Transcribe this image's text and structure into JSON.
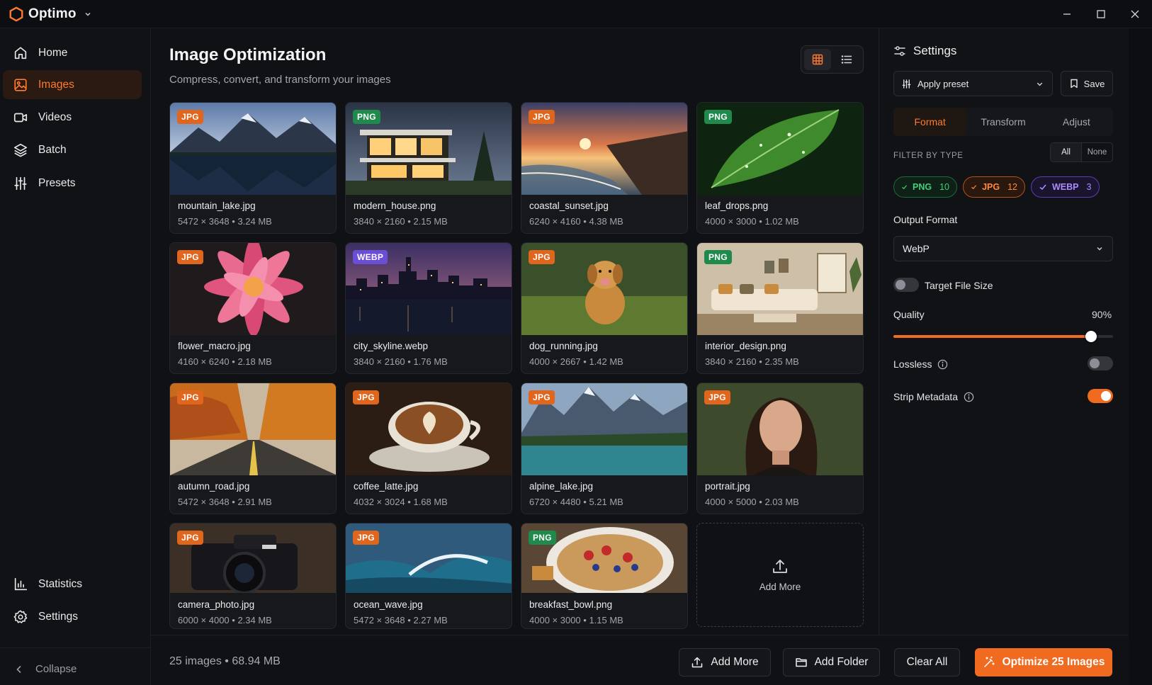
{
  "app": {
    "name": "Optimo"
  },
  "sidebar": {
    "items": [
      {
        "label": "Home",
        "icon": "home-icon"
      },
      {
        "label": "Images",
        "icon": "image-icon",
        "active": true
      },
      {
        "label": "Videos",
        "icon": "video-icon"
      },
      {
        "label": "Batch",
        "icon": "layers-icon"
      },
      {
        "label": "Presets",
        "icon": "sliders-icon"
      }
    ],
    "bottom_items": [
      {
        "label": "Statistics",
        "icon": "bar-chart-icon"
      },
      {
        "label": "Settings",
        "icon": "gear-icon"
      }
    ],
    "collapse_label": "Collapse"
  },
  "main": {
    "title": "Image Optimization",
    "subtitle": "Compress, convert, and transform your images",
    "view_mode": "grid"
  },
  "images": [
    {
      "name": "mountain_lake.jpg",
      "type": "JPG",
      "dims": "5472 × 3648",
      "size": "3.24 MB"
    },
    {
      "name": "modern_house.png",
      "type": "PNG",
      "dims": "3840 × 2160",
      "size": "2.15 MB"
    },
    {
      "name": "coastal_sunset.jpg",
      "type": "JPG",
      "dims": "6240 × 4160",
      "size": "4.38 MB"
    },
    {
      "name": "leaf_drops.png",
      "type": "PNG",
      "dims": "4000 × 3000",
      "size": "1.02 MB"
    },
    {
      "name": "flower_macro.jpg",
      "type": "JPG",
      "dims": "4160 × 6240",
      "size": "2.18 MB"
    },
    {
      "name": "city_skyline.webp",
      "type": "WEBP",
      "dims": "3840 × 2160",
      "size": "1.76 MB"
    },
    {
      "name": "dog_running.jpg",
      "type": "JPG",
      "dims": "4000 × 2667",
      "size": "1.42 MB"
    },
    {
      "name": "interior_design.png",
      "type": "PNG",
      "dims": "3840 × 2160",
      "size": "2.35 MB"
    },
    {
      "name": "autumn_road.jpg",
      "type": "JPG",
      "dims": "5472 × 3648",
      "size": "2.91 MB"
    },
    {
      "name": "coffee_latte.jpg",
      "type": "JPG",
      "dims": "4032 × 3024",
      "size": "1.68 MB"
    },
    {
      "name": "alpine_lake.jpg",
      "type": "JPG",
      "dims": "6720 × 4480",
      "size": "5.21 MB"
    },
    {
      "name": "portrait.jpg",
      "type": "JPG",
      "dims": "4000 × 5000",
      "size": "2.03 MB"
    },
    {
      "name": "camera_photo.jpg",
      "type": "JPG",
      "dims": "6000 × 4000",
      "size": "2.34 MB"
    },
    {
      "name": "ocean_wave.jpg",
      "type": "JPG",
      "dims": "5472 × 3648",
      "size": "2.27 MB"
    },
    {
      "name": "breakfast_bowl.png",
      "type": "PNG",
      "dims": "4000 × 3000",
      "size": "1.15 MB"
    }
  ],
  "add_more_card_label": "Add More",
  "footer": {
    "count": "25 images",
    "total_size": "68.94 MB",
    "add_more": "Add More",
    "add_folder": "Add Folder",
    "clear_all": "Clear All",
    "optimize": "Optimize 25 Images"
  },
  "settings": {
    "title": "Settings",
    "preset_placeholder": "Apply preset",
    "save": "Save",
    "tabs": [
      "Format",
      "Transform",
      "Adjust"
    ],
    "active_tab": "Format",
    "filter_label": "FILTER BY TYPE",
    "filter_all": "All",
    "filter_none": "None",
    "filters": [
      {
        "label": "PNG",
        "count": "10",
        "checked": true
      },
      {
        "label": "JPG",
        "count": "12",
        "checked": true
      },
      {
        "label": "WEBP",
        "count": "3",
        "checked": true
      }
    ],
    "output_format_label": "Output Format",
    "output_format": "WebP",
    "target_file_size_label": "Target File Size",
    "target_file_size_on": false,
    "quality_label": "Quality",
    "quality_value": "90%",
    "quality_fraction": 0.9,
    "lossless_label": "Lossless",
    "lossless_on": false,
    "strip_metadata_label": "Strip Metadata",
    "strip_metadata_on": true
  },
  "colors": {
    "accent": "#f06b1f",
    "badge_jpg": "#e0661d",
    "badge_png": "#1f8a4c",
    "badge_webp": "#6a4fd6"
  }
}
